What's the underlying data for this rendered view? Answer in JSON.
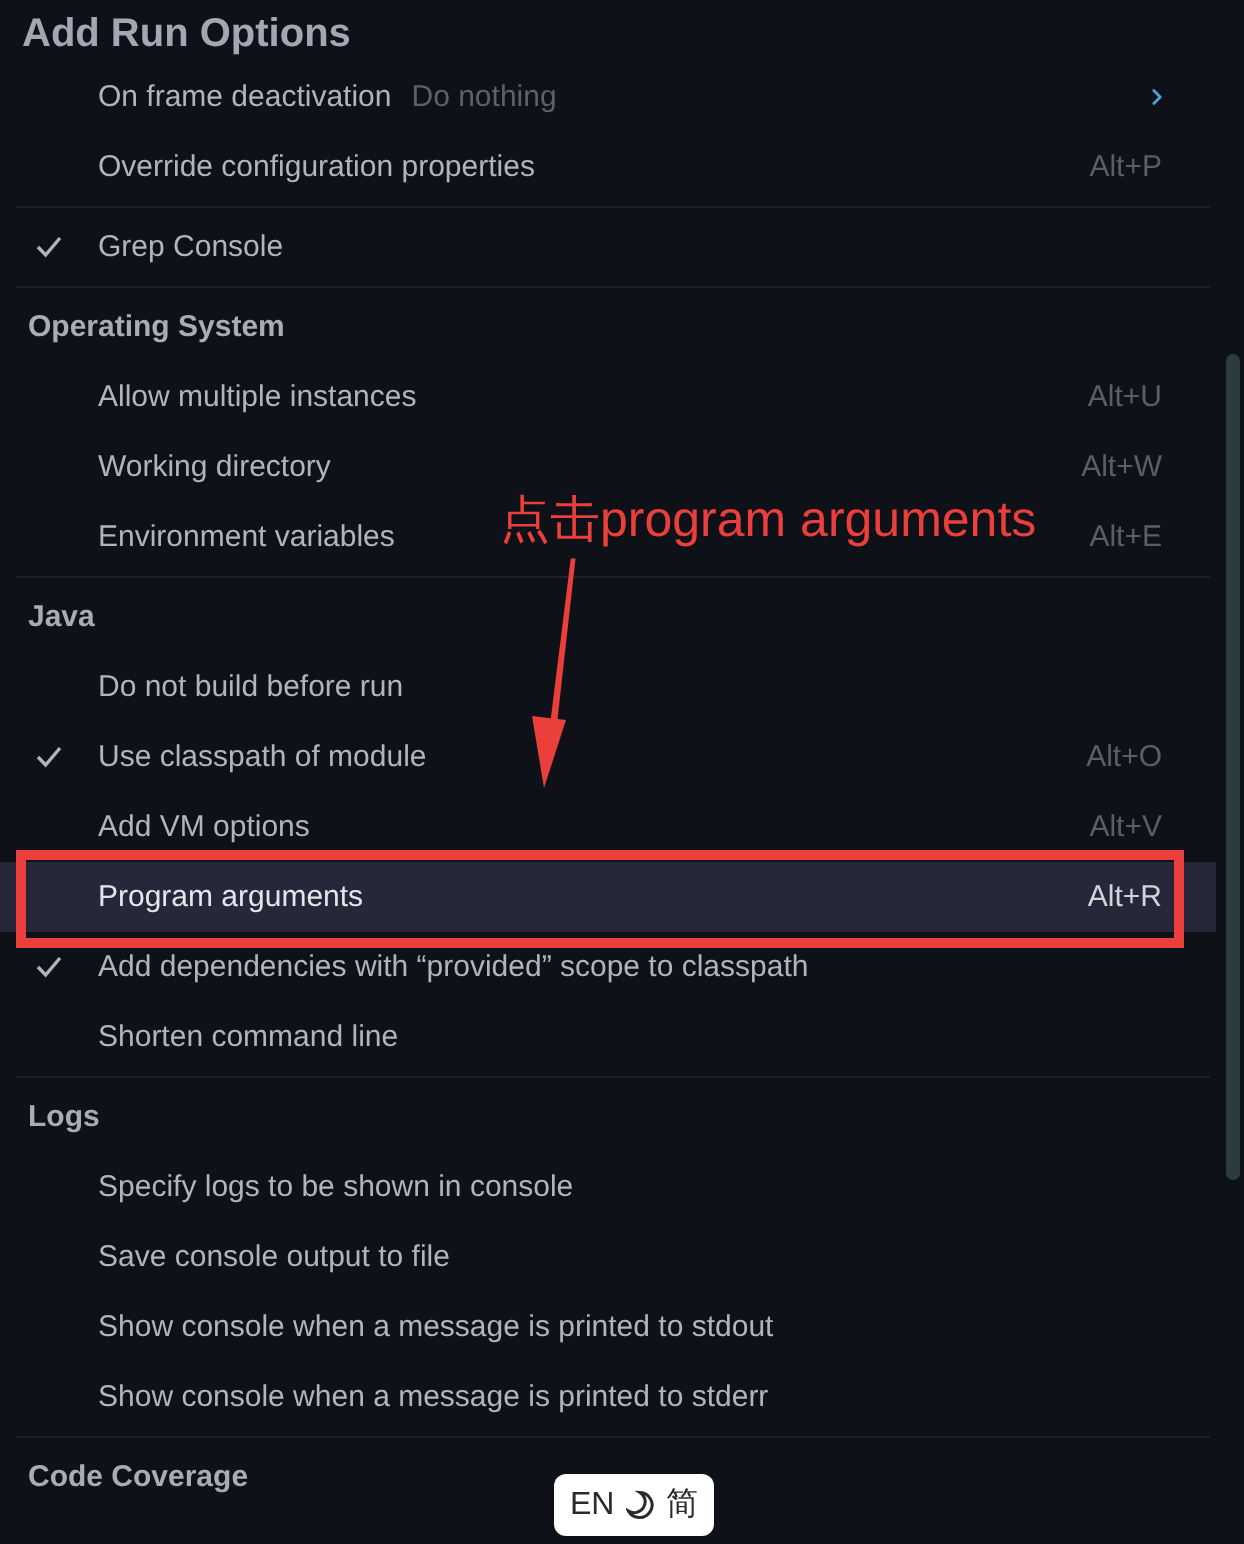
{
  "title": "Add Run Options",
  "sections": [
    {
      "items": [
        {
          "kind": "submenu",
          "label": "On frame deactivation",
          "value": "Do nothing",
          "checked": false,
          "selected": false
        },
        {
          "kind": "option",
          "label": "Override configuration properties",
          "shortcut": "Alt+P",
          "checked": false,
          "selected": false
        }
      ]
    },
    {
      "items": [
        {
          "kind": "option",
          "label": "Grep Console",
          "checked": true,
          "selected": false
        }
      ]
    },
    {
      "heading": "Operating System",
      "items": [
        {
          "kind": "option",
          "label": "Allow multiple instances",
          "shortcut": "Alt+U",
          "checked": false,
          "selected": false
        },
        {
          "kind": "option",
          "label": "Working directory",
          "shortcut": "Alt+W",
          "checked": false,
          "selected": false
        },
        {
          "kind": "option",
          "label": "Environment variables",
          "shortcut": "Alt+E",
          "checked": false,
          "selected": false
        }
      ]
    },
    {
      "heading": "Java",
      "items": [
        {
          "kind": "option",
          "label": "Do not build before run",
          "checked": false,
          "selected": false
        },
        {
          "kind": "option",
          "label": "Use classpath of module",
          "shortcut": "Alt+O",
          "checked": true,
          "selected": false
        },
        {
          "kind": "option",
          "label": "Add VM options",
          "shortcut": "Alt+V",
          "checked": false,
          "selected": false
        },
        {
          "kind": "option",
          "label": "Program arguments",
          "shortcut": "Alt+R",
          "checked": false,
          "selected": true
        },
        {
          "kind": "option",
          "label": "Add dependencies with “provided” scope to classpath",
          "checked": true,
          "selected": false
        },
        {
          "kind": "option",
          "label": "Shorten command line",
          "checked": false,
          "selected": false
        }
      ]
    },
    {
      "heading": "Logs",
      "items": [
        {
          "kind": "option",
          "label": "Specify logs to be shown in console",
          "checked": false,
          "selected": false
        },
        {
          "kind": "option",
          "label": "Save console output to file",
          "checked": false,
          "selected": false
        },
        {
          "kind": "option",
          "label": "Show console when a message is printed to stdout",
          "checked": false,
          "selected": false
        },
        {
          "kind": "option",
          "label": "Show console when a message is printed to stderr",
          "checked": false,
          "selected": false
        }
      ]
    },
    {
      "heading": "Code Coverage"
    }
  ],
  "annotation": {
    "text": "点击program arguments"
  },
  "ime_indicator": {
    "language": "EN",
    "mode": "简"
  }
}
